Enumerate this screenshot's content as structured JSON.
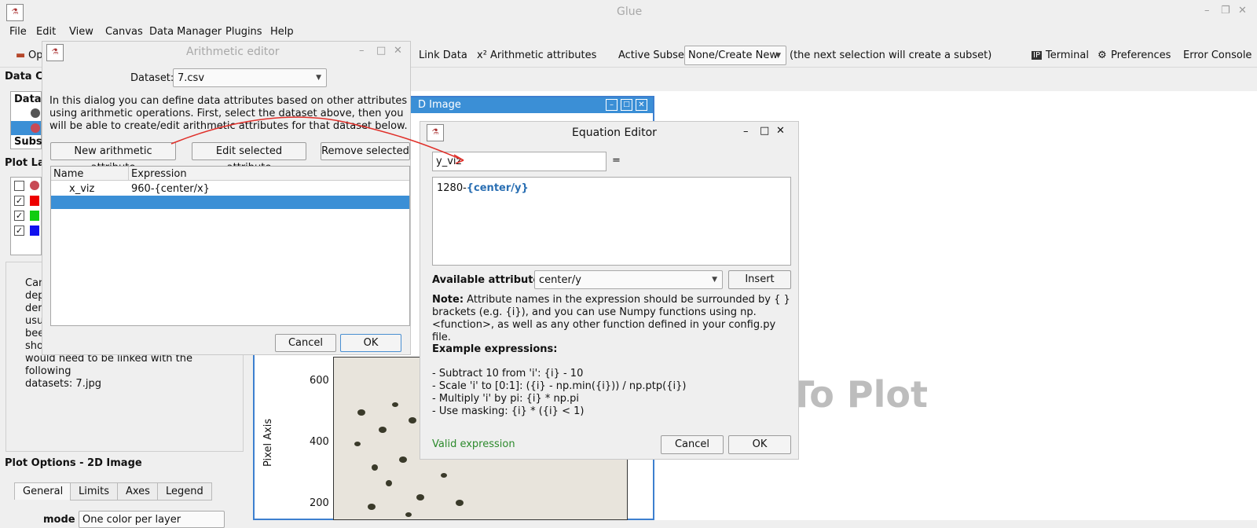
{
  "app": {
    "title": "Glue"
  },
  "menu": [
    "File",
    "Edit",
    "View",
    "Canvas",
    "Data Manager",
    "Plugins",
    "Help"
  ],
  "toolbar": {
    "open_label": "Op",
    "link_data": "Link Data",
    "arith_attrs": "x² Arithmetic attributes",
    "active_subset_label": "Active Subset:",
    "active_subset_value": "None/Create New",
    "subset_hint": "(the next selection will create a subset)",
    "terminal": "Terminal",
    "preferences": "Preferences",
    "error_console": "Error Console"
  },
  "left_panel": {
    "data_collection_title": "Data Co",
    "data_header": "Data",
    "subsets_header": "Subse",
    "plot_layers_title": "Plot La",
    "description_lines": [
      "Can",
      "dep",
      "der",
      "usu",
      "bee",
      "sho",
      "would need to be linked with the following",
      "datasets: 7.jpg"
    ],
    "plot_options_title": "Plot Options - 2D Image",
    "tabs": [
      "General",
      "Limits",
      "Axes",
      "Legend"
    ],
    "mode_label": "mode",
    "mode_value": "One color per layer"
  },
  "image_window": {
    "title": "D Image",
    "ylabel": "Pixel Axis",
    "yticks": [
      "600",
      "400",
      "200"
    ],
    "no_plot_text": "To Plot"
  },
  "arith_editor": {
    "title": "Arithmetic editor",
    "dataset_label": "Dataset:",
    "dataset_value": "7.csv",
    "intro": "In this dialog you can define data attributes based on other attributes using arithmetic operations. First, select the dataset above, then you will be able to create/edit arithmetic attributes for that dataset below.",
    "new_btn": "New arithmetic attribute",
    "edit_btn": "Edit selected attribute",
    "remove_btn": "Remove selected",
    "col_name": "Name",
    "col_expr": "Expression",
    "rows": [
      {
        "name": "x_viz",
        "expr": "960-{center/x}"
      },
      {
        "name": "",
        "expr": ""
      }
    ],
    "cancel": "Cancel",
    "ok": "OK"
  },
  "equation_editor": {
    "title": "Equation Editor",
    "name_value": "y_viz",
    "equals": "=",
    "expr_prefix": "1280-",
    "expr_attr": "{center/y}",
    "available_label": "Available attributes:",
    "available_value": "center/y",
    "insert_btn": "Insert",
    "note_bold": "Note:",
    "note_text": " Attribute names in the expression should be surrounded by { } brackets (e.g. {i}), and you can use Numpy functions using np.<function>, as well as any other function defined in your config.py file.",
    "examples_title": "Example expressions:",
    "examples": [
      "- Subtract 10 from 'i': {i} - 10",
      "- Scale 'i' to [0:1]: ({i} - np.min({i})) / np.ptp({i})",
      "- Multiply 'i' by pi: {i} * np.pi",
      "- Use masking: {i} * ({i} < 1)"
    ],
    "status": "Valid expression",
    "cancel": "Cancel",
    "ok": "OK"
  },
  "colors": {
    "accent": "#3b8fd6",
    "valid": "#2c8a2c",
    "annotation": "#e0302a"
  }
}
